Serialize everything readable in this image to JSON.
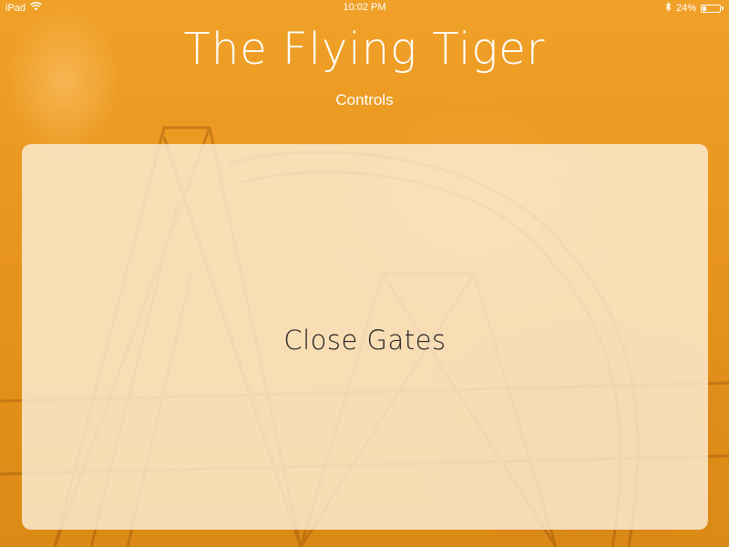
{
  "status_bar": {
    "device": "iPad",
    "time": "10:02 PM",
    "battery_percent": "24%",
    "battery_level": 0.24,
    "icons": [
      "wifi-icon",
      "bluetooth-icon",
      "battery-icon"
    ]
  },
  "header": {
    "title": "The Flying Tiger",
    "subtitle": "Controls"
  },
  "main": {
    "action_label": "Close Gates"
  },
  "colors": {
    "background": "#e8961c",
    "panel": "#fdf0dc",
    "text_light": "#ffffff",
    "text_dark": "#222222"
  }
}
